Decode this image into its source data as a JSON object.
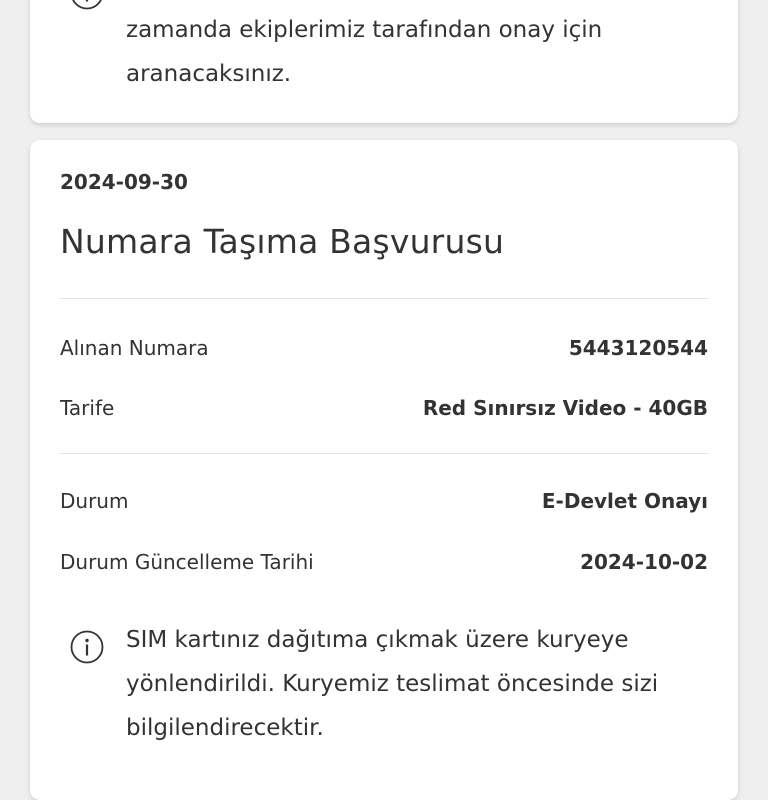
{
  "top_notice": {
    "icon": "info-icon",
    "text": "Başvurunuz başarıyla alınmıştır. En kısa zamanda ekiplerimiz tarafından onay için aranacaksınız."
  },
  "application": {
    "date": "2024-09-30",
    "title": "Numara Taşıma Başvurusu",
    "details": [
      {
        "label": "Alınan Numara",
        "value": "5443120544"
      },
      {
        "label": "Tarife",
        "value": "Red Sınırsız Video - 40GB"
      }
    ],
    "status": [
      {
        "label": "Durum",
        "value": "E-Devlet Onayı"
      },
      {
        "label": "Durum Güncelleme Tarihi",
        "value": "2024-10-02"
      }
    ],
    "notice": {
      "icon": "info-icon",
      "text": "SIM kartınız dağıtıma çıkmak üzere kuryeye yönlendirildi. Kuryemiz teslimat öncesinde sizi bilgilendirecektir."
    }
  }
}
